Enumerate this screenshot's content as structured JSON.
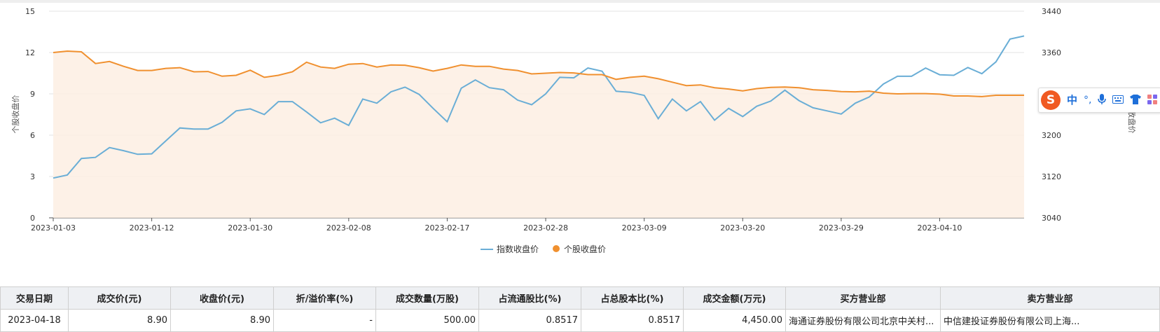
{
  "chart_data": {
    "type": "line",
    "ylabel_left": "个股收盘价",
    "ylabel_right": "指数收盘价",
    "ylim_left": [
      0,
      15
    ],
    "ylim_right": [
      3040,
      3440
    ],
    "yticks_left": [
      "0",
      "3",
      "6",
      "9",
      "12",
      "15"
    ],
    "yticks_right": [
      "3040",
      "3120",
      "3200",
      "3280",
      "3360",
      "3440"
    ],
    "xtick_labels": [
      "2023-01-03",
      "2023-01-12",
      "2023-01-30",
      "2023-02-08",
      "2023-02-17",
      "2023-02-28",
      "2023-03-09",
      "2023-03-20",
      "2023-03-29",
      "2023-04-10"
    ],
    "legend_position": "bottom-center",
    "grid": true,
    "x": [
      "2023-01-03",
      "2023-01-04",
      "2023-01-05",
      "2023-01-06",
      "2023-01-09",
      "2023-01-10",
      "2023-01-11",
      "2023-01-12",
      "2023-01-13",
      "2023-01-16",
      "2023-01-17",
      "2023-01-18",
      "2023-01-19",
      "2023-01-20",
      "2023-01-30",
      "2023-01-31",
      "2023-02-01",
      "2023-02-02",
      "2023-02-03",
      "2023-02-06",
      "2023-02-07",
      "2023-02-08",
      "2023-02-09",
      "2023-02-10",
      "2023-02-13",
      "2023-02-14",
      "2023-02-15",
      "2023-02-16",
      "2023-02-17",
      "2023-02-20",
      "2023-02-21",
      "2023-02-22",
      "2023-02-23",
      "2023-02-24",
      "2023-02-27",
      "2023-02-28",
      "2023-03-01",
      "2023-03-02",
      "2023-03-03",
      "2023-03-06",
      "2023-03-07",
      "2023-03-08",
      "2023-03-09",
      "2023-03-10",
      "2023-03-13",
      "2023-03-14",
      "2023-03-15",
      "2023-03-16",
      "2023-03-17",
      "2023-03-20",
      "2023-03-21",
      "2023-03-22",
      "2023-03-23",
      "2023-03-24",
      "2023-03-27",
      "2023-03-28",
      "2023-03-29",
      "2023-03-30",
      "2023-03-31",
      "2023-04-03",
      "2023-04-04",
      "2023-04-06",
      "2023-04-07",
      "2023-04-10",
      "2023-04-11",
      "2023-04-12",
      "2023-04-13",
      "2023-04-14",
      "2023-04-17",
      "2023-04-18"
    ],
    "series": [
      {
        "name": "指数收盘价",
        "axis": "right",
        "color": "#6aaed6",
        "values": [
          3117,
          3123,
          3155,
          3157,
          3176,
          3170,
          3163,
          3164,
          3189,
          3214,
          3212,
          3212,
          3225,
          3247,
          3251,
          3240,
          3265,
          3265,
          3245,
          3224,
          3233,
          3219,
          3270,
          3262,
          3284,
          3293,
          3279,
          3252,
          3226,
          3291,
          3307,
          3292,
          3288,
          3268,
          3259,
          3280,
          3312,
          3311,
          3330,
          3324,
          3285,
          3283,
          3277,
          3232,
          3270,
          3247,
          3265,
          3229,
          3252,
          3236,
          3256,
          3266,
          3287,
          3267,
          3253,
          3247,
          3241,
          3262,
          3274,
          3299,
          3314,
          3314,
          3330,
          3317,
          3316,
          3331,
          3319,
          3342,
          3386,
          3392
        ]
      },
      {
        "name": "个股收盘价",
        "axis": "left",
        "color": "#f0902f",
        "values": [
          12.0,
          12.1,
          12.05,
          11.2,
          11.35,
          11.0,
          10.7,
          10.7,
          10.85,
          10.9,
          10.6,
          10.62,
          10.28,
          10.35,
          10.72,
          10.2,
          10.35,
          10.6,
          11.3,
          10.95,
          10.85,
          11.15,
          11.2,
          10.95,
          11.1,
          11.08,
          10.9,
          10.65,
          10.85,
          11.1,
          11.0,
          11.0,
          10.8,
          10.7,
          10.45,
          10.5,
          10.55,
          10.52,
          10.4,
          10.4,
          10.05,
          10.2,
          10.28,
          10.1,
          9.85,
          9.6,
          9.65,
          9.45,
          9.35,
          9.22,
          9.38,
          9.47,
          9.5,
          9.45,
          9.3,
          9.25,
          9.17,
          9.15,
          9.2,
          9.05,
          9.0,
          9.02,
          9.02,
          8.98,
          8.85,
          8.85,
          8.8,
          8.9,
          8.9,
          8.9
        ]
      }
    ]
  },
  "ime_toolbar": {
    "logo": "S",
    "icons": [
      "zh-mode-icon",
      "punctuation-icon",
      "microphone-icon",
      "keyboard-icon",
      "skin-icon",
      "apps-icon"
    ],
    "zh": "中",
    "punct": "°,"
  },
  "table": {
    "headers": [
      "交易日期",
      "成交价(元)",
      "收盘价(元)",
      "折/溢价率(%)",
      "成交数量(万股)",
      "占流通股比(%)",
      "占总股本比(%)",
      "成交金额(万元)",
      "买方营业部",
      "卖方营业部"
    ],
    "rows": [
      [
        "2023-04-18",
        "8.90",
        "8.90",
        "-",
        "500.00",
        "0.8517",
        "0.8517",
        "4,450.00",
        "海通证券股份有限公司北京中关村...",
        "中信建投证券股份有限公司上海..."
      ]
    ]
  }
}
